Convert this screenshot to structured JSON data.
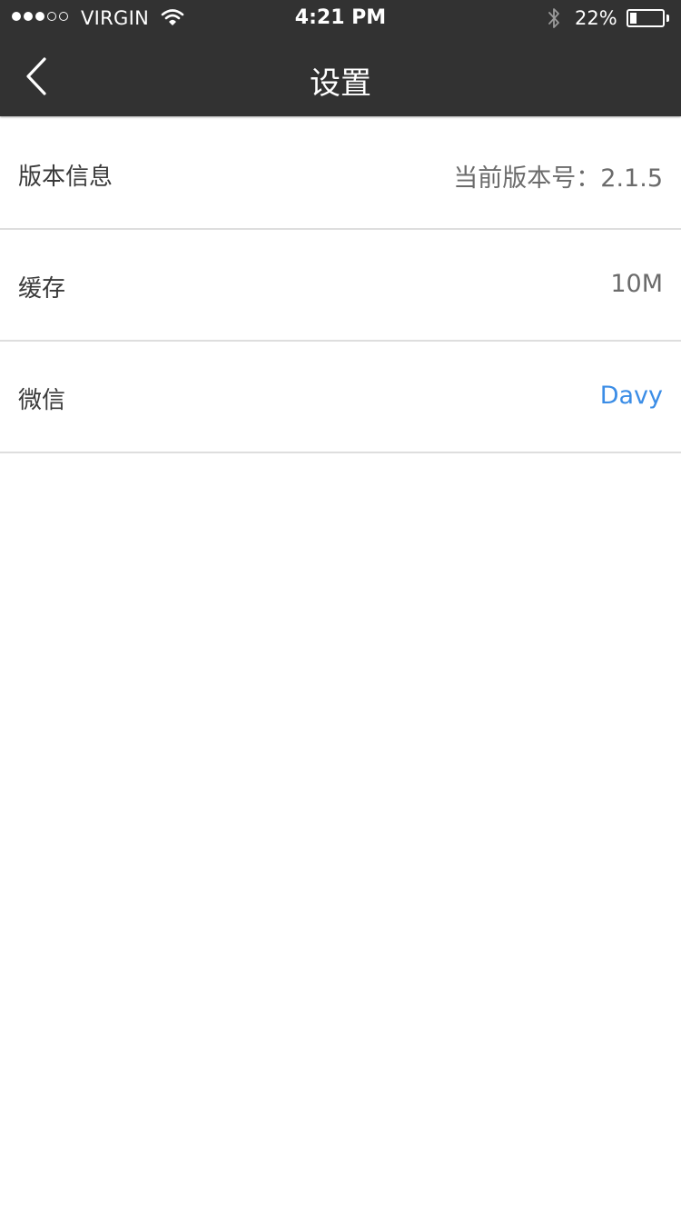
{
  "status_bar": {
    "signal_filled": 3,
    "signal_total": 5,
    "carrier": "VIRGIN",
    "time": "4:21 PM",
    "battery_text": "22%",
    "battery_level": 0.22,
    "icons": [
      "wifi-icon",
      "bluetooth-icon",
      "battery-icon"
    ]
  },
  "nav": {
    "back_icon": "chevron-left-icon",
    "title": "设置"
  },
  "settings": [
    {
      "label": "版本信息",
      "value": "当前版本号：2.1.5"
    },
    {
      "label": "缓存",
      "value": "10M"
    },
    {
      "label": "微信",
      "value": "Davy"
    }
  ],
  "colors": {
    "nav_background": "#323232",
    "link": "#3b8de6",
    "separator": "#dedede"
  }
}
